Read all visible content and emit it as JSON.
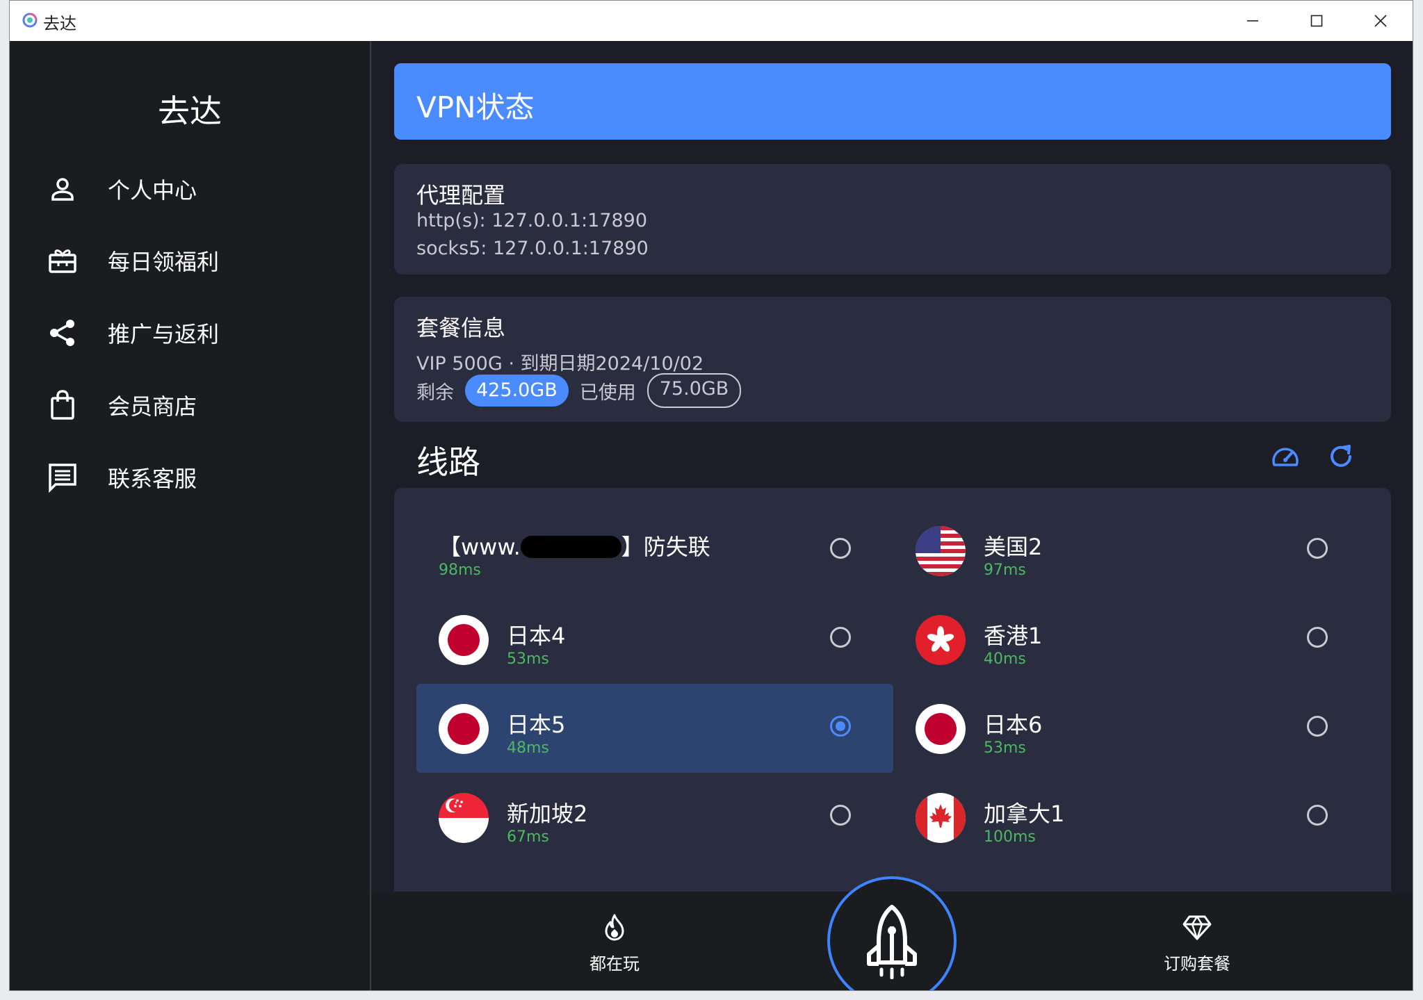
{
  "window": {
    "title": "去达",
    "controls": [
      "minimize",
      "maximize",
      "close"
    ]
  },
  "sidebar": {
    "brand": "去达",
    "items": [
      {
        "label": "个人中心",
        "icon": "person-icon"
      },
      {
        "label": "每日领福利",
        "icon": "gift-icon"
      },
      {
        "label": "推广与返利",
        "icon": "share-icon"
      },
      {
        "label": "会员商店",
        "icon": "shopping-bag-icon"
      },
      {
        "label": "联系客服",
        "icon": "chat-icon"
      }
    ]
  },
  "vpn_status": {
    "title": "VPN状态",
    "color": "#4a8cff"
  },
  "proxy": {
    "title": "代理配置",
    "http": "http(s): 127.0.0.1:17890",
    "socks": "socks5: 127.0.0.1:17890"
  },
  "plan": {
    "title": "套餐信息",
    "detail": "VIP 500G · 到期日期2024/10/02",
    "remaining_label": "剩余",
    "remaining_value": "425.0GB",
    "used_label": "已使用",
    "used_value": "75.0GB"
  },
  "routes": {
    "title": "线路",
    "tools": [
      "speedometer-icon",
      "refresh-icon"
    ],
    "items": [
      {
        "name_prefix": "【www.",
        "name_suffix": "】防失联",
        "latency": "98ms",
        "flag": "",
        "selected": false
      },
      {
        "name": "美国2",
        "latency": "97ms",
        "flag": "us-flag-icon",
        "selected": false
      },
      {
        "name": "日本4",
        "latency": "53ms",
        "flag": "jp-flag-icon",
        "selected": false
      },
      {
        "name": "香港1",
        "latency": "40ms",
        "flag": "hk-flag-icon",
        "selected": false
      },
      {
        "name": "日本5",
        "latency": "48ms",
        "flag": "jp-flag-icon",
        "selected": true
      },
      {
        "name": "日本6",
        "latency": "53ms",
        "flag": "jp-flag-icon",
        "selected": false
      },
      {
        "name": "新加坡2",
        "latency": "67ms",
        "flag": "sg-flag-icon",
        "selected": false
      },
      {
        "name": "加拿大1",
        "latency": "100ms",
        "flag": "ca-flag-icon",
        "selected": false
      }
    ],
    "latency_color": "#4cb861"
  },
  "bottom_nav": {
    "left": {
      "label": "都在玩",
      "icon": "flame-icon"
    },
    "center": {
      "icon": "rocket-icon",
      "accent": "#3d84ff"
    },
    "right": {
      "label": "订购套餐",
      "icon": "diamond-icon"
    }
  }
}
